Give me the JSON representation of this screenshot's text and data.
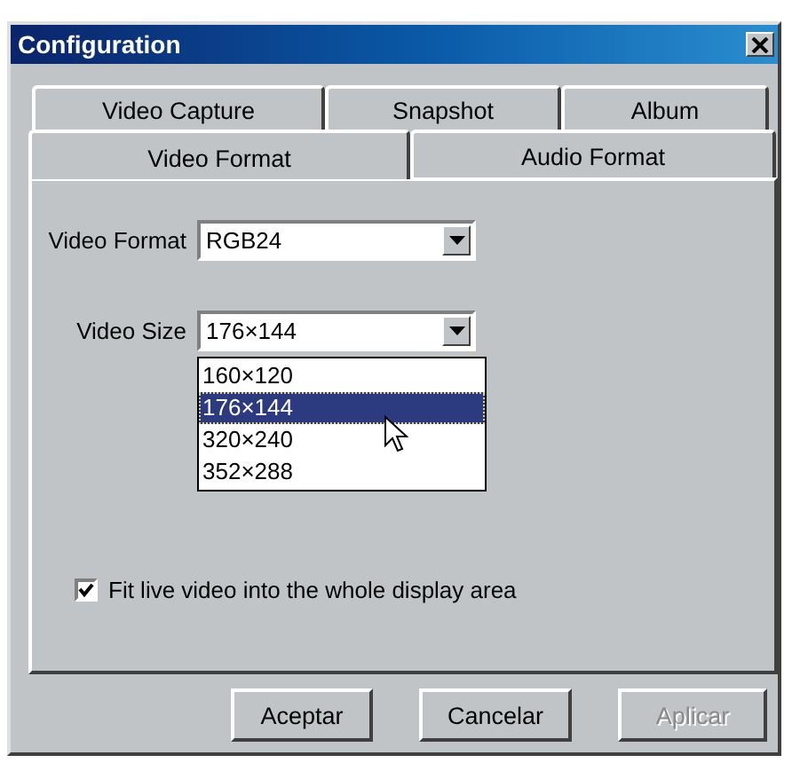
{
  "window": {
    "title": "Configuration"
  },
  "tab_rows": [
    [
      {
        "label": "Video Capture",
        "selected": false
      },
      {
        "label": "Snapshot",
        "selected": false
      },
      {
        "label": "Album",
        "selected": false
      }
    ],
    [
      {
        "label": "Video Format",
        "selected": true
      },
      {
        "label": "Audio Format",
        "selected": false
      }
    ]
  ],
  "video_format": {
    "label": "Video Format",
    "value": "RGB24"
  },
  "video_size": {
    "label": "Video Size",
    "value": "176×144",
    "expanded": true,
    "options": [
      {
        "label": "160×120",
        "selected": false
      },
      {
        "label": "176×144",
        "selected": true
      },
      {
        "label": "320×240",
        "selected": false
      },
      {
        "label": "352×288",
        "selected": false
      }
    ]
  },
  "fit_video": {
    "label": "Fit live video into the whole display area",
    "checked": true
  },
  "buttons": [
    {
      "label": "Aceptar",
      "disabled": false
    },
    {
      "label": "Cancelar",
      "disabled": false
    },
    {
      "label": "Aplicar",
      "disabled": true
    }
  ]
}
